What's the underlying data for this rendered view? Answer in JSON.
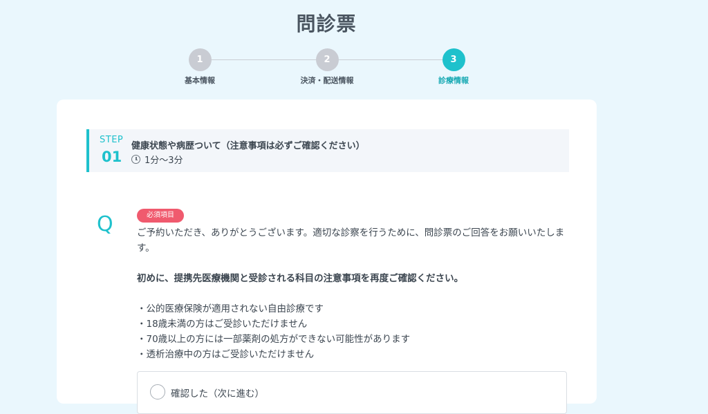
{
  "page": {
    "title": "問診票"
  },
  "stepper": {
    "steps": [
      {
        "number": "1",
        "label": "基本情報",
        "active": false
      },
      {
        "number": "2",
        "label": "決済・配送情報",
        "active": false
      },
      {
        "number": "3",
        "label": "診療情報",
        "active": true
      }
    ]
  },
  "section": {
    "step_word": "STEP",
    "step_number": "01",
    "heading": "健康状態や病歴ついて（注意事項は必ずご確認ください）",
    "time_icon": "clock-icon",
    "time": "1分〜3分"
  },
  "question": {
    "mark": "Q",
    "badge": "必須項目",
    "intro": "ご予約いただき、ありがとうございます。適切な診察を行うために、問診票のご回答をお願いいたします。",
    "emphasis": "初めに、提携先医療機関と受診される科目の注意事項を再度ご確認ください。",
    "notes": [
      "・公的医療保険が適用されない自由診療です",
      "・18歳未満の方はご受診いただけません",
      "・70歳以上の方には一部薬剤の処方ができない可能性があります",
      "・透析治療中の方はご受診いただけません"
    ],
    "option_label": "確認した（次に進む）"
  },
  "colors": {
    "accent": "#1ec1cc",
    "badge": "#f05a6e",
    "background": "#eaf7fd"
  }
}
